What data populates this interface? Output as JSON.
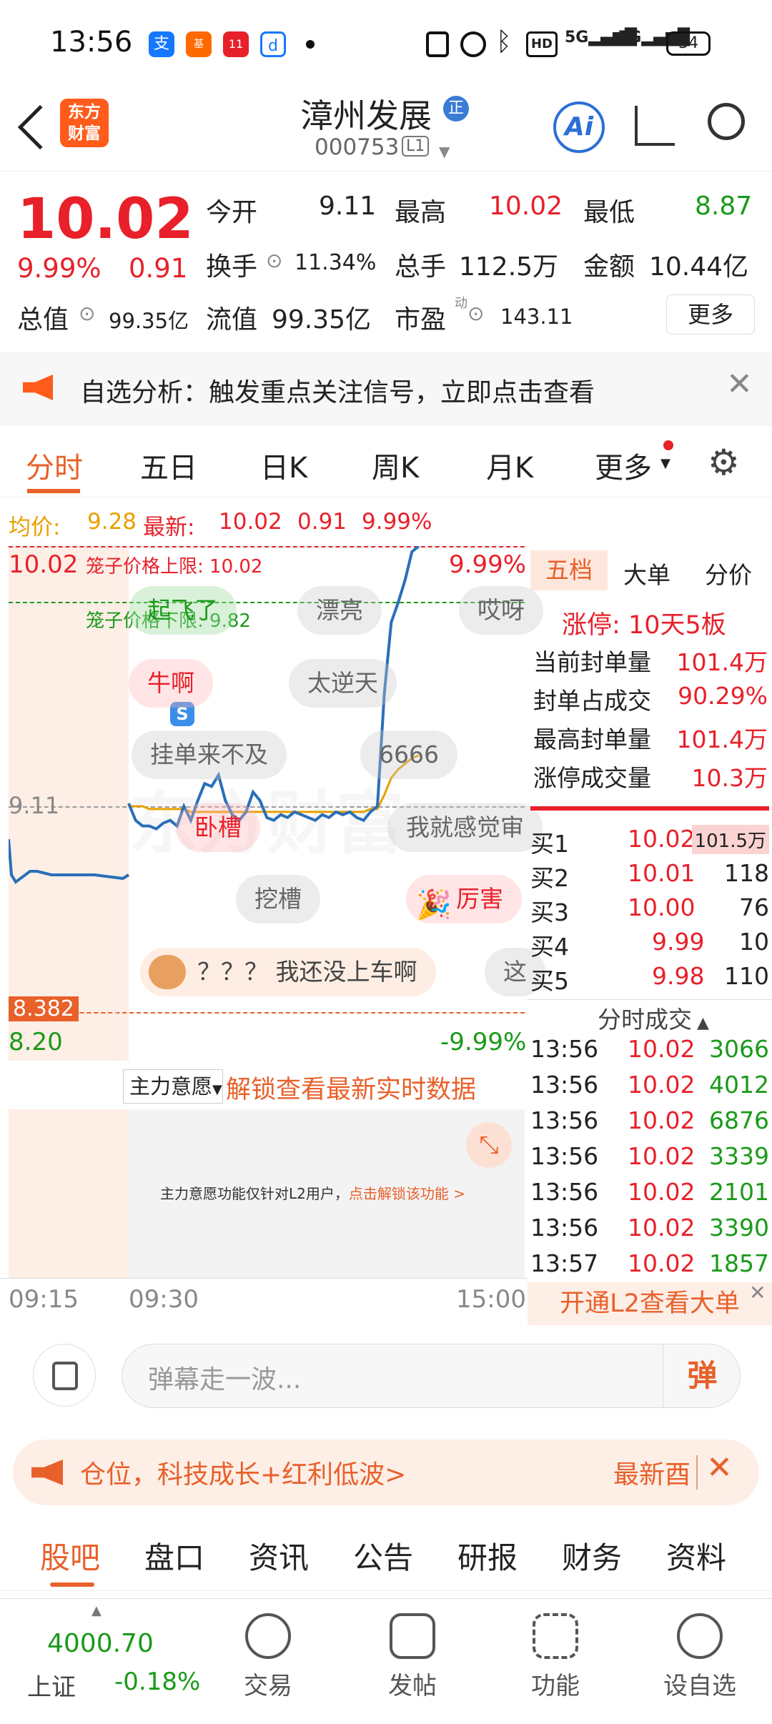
{
  "status_bar": {
    "time": "13:56",
    "battery": "34",
    "icons": [
      "alipay-icon",
      "fund-icon",
      "shopping-icon",
      "app-icon",
      "dot-icon",
      "nfc-icon",
      "alarm-icon",
      "bluetooth-icon",
      "hd-icon",
      "5g-signal-icon",
      "5g-signal-icon"
    ]
  },
  "header": {
    "logo_line1": "东方",
    "logo_line2": "财富",
    "stock_name": "漳州发展",
    "name_badge": "正",
    "stock_code": "000753",
    "level": "L1",
    "ai": "Ai"
  },
  "quote": {
    "price": "10.02",
    "change_pct": "9.99%",
    "change": "0.91",
    "open_label": "今开",
    "open": "9.11",
    "high_label": "最高",
    "high": "10.02",
    "low_label": "最低",
    "low": "8.87",
    "turnover_label": "换手",
    "turnover": "11.34%",
    "volume_label": "总手",
    "volume": "112.5万",
    "amount_label": "金额",
    "amount": "10.44亿",
    "mcap_label": "总值",
    "mcap": "99.35亿",
    "float_label": "流值",
    "float": "99.35亿",
    "pe_label": "市盈",
    "pe_sup": "动",
    "pe": "143.11",
    "more": "更多"
  },
  "notice": {
    "text": "自选分析：触发重点关注信号，立即点击查看"
  },
  "tabs": [
    "分时",
    "五日",
    "日K",
    "周K",
    "月K",
    "更多"
  ],
  "avg_bar": {
    "avg_label": "均价:",
    "avg": "9.28",
    "latest_label": "最新:",
    "latest": "10.02",
    "chg": "0.91",
    "pct": "9.99%"
  },
  "chart": {
    "top_price": "10.02",
    "top_pct": "9.99%",
    "upper_label": "笼子价格上限: 10.02",
    "lower_label": "笼子价格下限: 9.82",
    "mid_price": "9.11",
    "cursor_price": "8.382",
    "low_price": "8.20",
    "low_pct": "-9.99%",
    "s_marker": "S",
    "watermark": "东方财富",
    "bubbles": [
      "起飞了",
      "漂亮",
      "哎呀",
      "牛啊",
      "太逆天",
      "挂单来不及",
      "6666",
      "卧槽",
      "我就感觉审",
      "挖槽",
      "厉害",
      "？？？ 我还没上车啊",
      "这"
    ],
    "xaxis": [
      "09:15",
      "09:30",
      "15:00"
    ],
    "chart_data": {
      "type": "line",
      "x_label": "",
      "y_label": "",
      "yrange": [
        8.2,
        10.02
      ],
      "series": [
        {
          "values": [
            9.11,
            9.05,
            9.03,
            9.03,
            9.02,
            9.04,
            9.05,
            9.03,
            9.1,
            9.05,
            9.12,
            9.18,
            9.17,
            9.21,
            9.12,
            9.07,
            9.05,
            9.08,
            9.15,
            9.12,
            9.06,
            9.05,
            9.07,
            9.06,
            9.08,
            9.07,
            9.06,
            9.05,
            9.07,
            9.06,
            9.08,
            9.07,
            9.08,
            9.06,
            9.05,
            9.08,
            9.1,
            9.5,
            9.75,
            9.82,
            9.9,
            10.0,
            10.02
          ]
        },
        {
          "values": [
            9.1,
            9.1,
            9.1,
            9.09,
            9.09,
            9.09,
            9.09,
            9.09,
            9.09,
            9.08,
            9.08,
            9.08,
            9.08,
            9.08,
            9.08,
            9.08,
            9.08,
            9.08,
            9.08,
            9.08,
            9.08,
            9.08,
            9.08,
            9.08,
            9.08,
            9.08,
            9.08,
            9.08,
            9.08,
            9.08,
            9.08,
            9.08,
            9.08,
            9.08,
            9.08,
            9.09,
            9.09,
            9.14,
            9.2,
            9.23,
            9.25,
            9.27,
            9.28
          ]
        }
      ]
    }
  },
  "main_force": {
    "label": "主力意愿",
    "unlock": "解锁查看最新实时数据",
    "msg": "主力意愿功能仅针对L2用户，",
    "link": "点击解锁该功能 >"
  },
  "side": {
    "tabs": [
      "五档",
      "大单",
      "分价"
    ],
    "limit_up_label": "涨停:",
    "limit_up": "10天5板",
    "stats": [
      {
        "label": "当前封单量",
        "value": "101.4万"
      },
      {
        "label": "封单占成交",
        "value": "90.29%"
      },
      {
        "label": "最高封单量",
        "value": "101.4万"
      },
      {
        "label": "涨停成交量",
        "value": "10.3万"
      }
    ],
    "bids": [
      {
        "label": "买1",
        "price": "10.02",
        "vol": "101.5万"
      },
      {
        "label": "买2",
        "price": "10.01",
        "vol": "118"
      },
      {
        "label": "买3",
        "price": "10.00",
        "vol": "76"
      },
      {
        "label": "买4",
        "price": "9.99",
        "vol": "10"
      },
      {
        "label": "买5",
        "price": "9.98",
        "vol": "110"
      }
    ],
    "ticks_title": "分时成交",
    "ticks": [
      {
        "t": "13:56",
        "p": "10.02",
        "v": "3066"
      },
      {
        "t": "13:56",
        "p": "10.02",
        "v": "4012"
      },
      {
        "t": "13:56",
        "p": "10.02",
        "v": "6876"
      },
      {
        "t": "13:56",
        "p": "10.02",
        "v": "3339"
      },
      {
        "t": "13:56",
        "p": "10.02",
        "v": "2101"
      },
      {
        "t": "13:56",
        "p": "10.02",
        "v": "3390"
      },
      {
        "t": "13:57",
        "p": "10.02",
        "v": "1857"
      }
    ],
    "l2": "开通L2查看大单"
  },
  "comment": {
    "placeholder": "弹幕走一波...",
    "send": "弹"
  },
  "banner": {
    "text": "仓位，科技成长+红利低波>",
    "right": "最新酉"
  },
  "subtabs": [
    "股吧",
    "盘口",
    "资讯",
    "公告",
    "研报",
    "财务",
    "资料"
  ],
  "tabbar": {
    "index_value": "4000.70",
    "index_name": "上证",
    "index_chg": "-0.18%",
    "items": [
      "交易",
      "发帖",
      "功能",
      "设自选"
    ]
  }
}
